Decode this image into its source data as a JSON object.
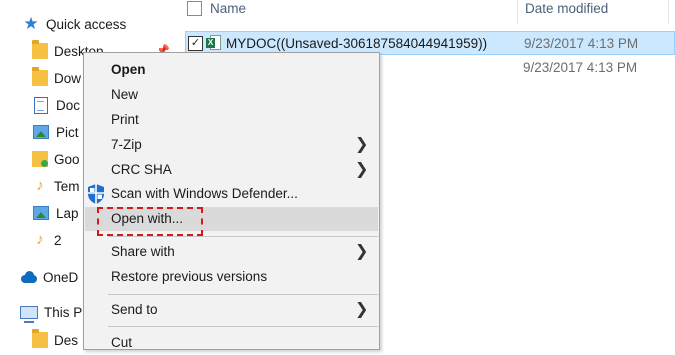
{
  "nav": {
    "items": [
      {
        "label": "Quick access",
        "icon": "star-icon"
      },
      {
        "label": "Desktop",
        "icon": "folder-icon"
      },
      {
        "label": "Dow",
        "icon": "folder-icon"
      },
      {
        "label": "Doc",
        "icon": "documents-icon"
      },
      {
        "label": "Pict",
        "icon": "pictures-icon"
      },
      {
        "label": "Goo",
        "icon": "google-drive-icon"
      },
      {
        "label": "Tem",
        "icon": "music-icon"
      },
      {
        "label": "Lap",
        "icon": "pictures-icon"
      },
      {
        "label": "2",
        "icon": "music-icon"
      },
      {
        "label": "OneD",
        "icon": "onedrive-icon"
      },
      {
        "label": "This P",
        "icon": "this-pc-icon"
      },
      {
        "label": "Des",
        "icon": "folder-icon"
      }
    ]
  },
  "file_list": {
    "columns": {
      "name": "Name",
      "date": "Date modified"
    },
    "rows": [
      {
        "name": "MYDOC((Unsaved-306187584044941959))",
        "date": "9/23/2017 4:13 PM",
        "selected": true,
        "checkmark": "✓"
      },
      {
        "name": "",
        "date": "9/23/2017 4:13 PM",
        "selected": false
      }
    ]
  },
  "context_menu": {
    "items": [
      {
        "label": "Open",
        "bold": true
      },
      {
        "label": "New"
      },
      {
        "label": "Print"
      },
      {
        "label": "7-Zip",
        "submenu": true
      },
      {
        "label": "CRC SHA",
        "submenu": true
      },
      {
        "label": "Scan with Windows Defender...",
        "icon": "windows-defender-shield-icon"
      },
      {
        "label": "Open with...",
        "highlighted": true
      },
      {
        "label": "Share with",
        "submenu": true
      },
      {
        "label": "Restore previous versions"
      },
      {
        "label": "Send to",
        "submenu": true
      },
      {
        "label": "Cut"
      }
    ],
    "chevron": "❯"
  },
  "colors": {
    "selection": "#cce8ff",
    "menu_background": "#f2f2f2",
    "menu_hover": "#dadada",
    "callout_red": "#d21a1a",
    "excel_green": "#1d7a45"
  }
}
